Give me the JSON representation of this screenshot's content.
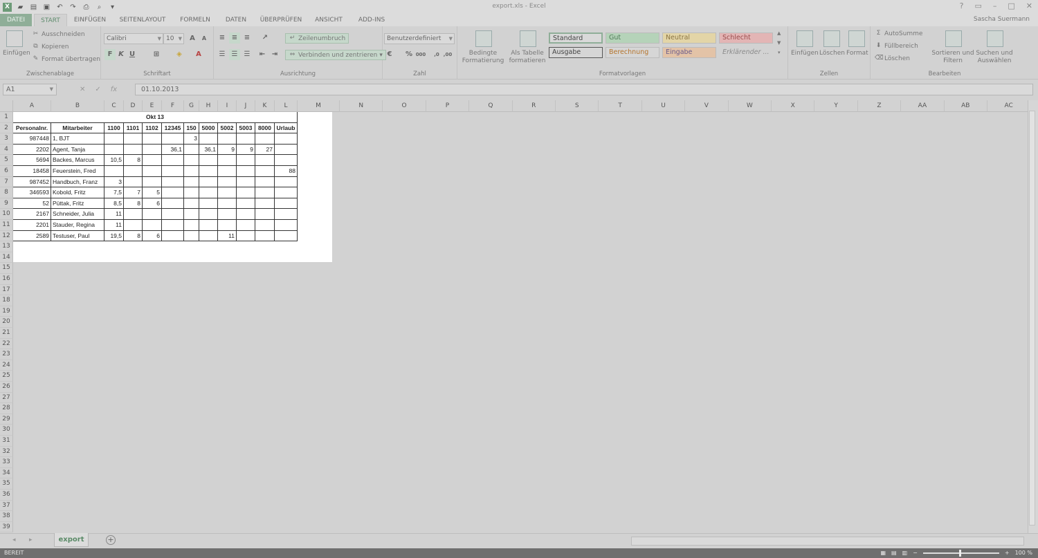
{
  "window": {
    "title": "export.xls - Excel",
    "user": "Sascha Suermann"
  },
  "menu": {
    "tabs": [
      "DATEI",
      "START",
      "EINFÜGEN",
      "SEITENLAYOUT",
      "FORMELN",
      "DATEN",
      "ÜBERPRÜFEN",
      "ANSICHT",
      "ADD-INS"
    ]
  },
  "ribbon": {
    "clipboard": {
      "label": "Zwischenablage",
      "paste": "Einfügen",
      "cut": "Ausschneiden",
      "copy": "Kopieren",
      "format_painter": "Format übertragen"
    },
    "font": {
      "label": "Schriftart",
      "family": "Calibri",
      "size": "10",
      "bold": "F",
      "italic": "K",
      "underline": "U"
    },
    "alignment": {
      "label": "Ausrichtung",
      "wrap": "Zeilenumbruch",
      "merge": "Verbinden und zentrieren"
    },
    "number": {
      "label": "Zahl",
      "format": "Benutzerdefiniert",
      "percent": "%",
      "thousands": "000"
    },
    "styles": {
      "label": "Formatvorlagen",
      "conditional": "Bedingte Formatierung",
      "as_table": "Als Tabelle formatieren",
      "items": [
        {
          "name": "Standard",
          "bg": "#d9d9d9",
          "fg": "#444444"
        },
        {
          "name": "Gut",
          "bg": "#b5d3b9",
          "fg": "#4f7a58"
        },
        {
          "name": "Neutral",
          "bg": "#e3d5a7",
          "fg": "#8a7443"
        },
        {
          "name": "Schlecht",
          "bg": "#e3b5b5",
          "fg": "#9a4c4c"
        },
        {
          "name": "Ausgabe",
          "bg": "#d6d6d6",
          "fg": "#444444"
        },
        {
          "name": "Berechnung",
          "bg": "#d6d6d6",
          "fg": "#b5742c"
        },
        {
          "name": "Eingabe",
          "bg": "#e3c3a7",
          "fg": "#6a5a8a"
        },
        {
          "name": "Erklärender ...",
          "bg": "#d2d2d2",
          "fg": "#8a8a8a"
        }
      ]
    },
    "cells": {
      "label": "Zellen",
      "insert": "Einfügen",
      "delete": "Löschen",
      "format": "Format"
    },
    "editing": {
      "label": "Bearbeiten",
      "autosum": "AutoSumme",
      "fill": "Füllbereich",
      "clear": "Löschen",
      "sort": "Sortieren und Filtern",
      "find": "Suchen und Auswählen"
    }
  },
  "formula": {
    "namebox": "A1",
    "value": "01.10.2013"
  },
  "grid": {
    "columns": [
      "A",
      "B",
      "C",
      "D",
      "E",
      "F",
      "G",
      "H",
      "I",
      "J",
      "K",
      "L",
      "M",
      "N",
      "O",
      "P",
      "Q",
      "R",
      "S",
      "T",
      "U",
      "V",
      "W",
      "X",
      "Y",
      "Z",
      "AA",
      "AB",
      "AC"
    ],
    "row_count": 39,
    "title": "Okt 13",
    "headers": [
      "Personalnr.",
      "Mitarbeiter",
      "1100",
      "1101",
      "1102",
      "12345",
      "150",
      "5000",
      "5002",
      "5003",
      "8000",
      "Urlaub"
    ],
    "rows": [
      [
        "987448",
        "1, BJT",
        "",
        "",
        "",
        "",
        "3",
        "",
        "",
        "",
        "",
        ""
      ],
      [
        "2202",
        "Agent, Tanja",
        "",
        "",
        "",
        "36,1",
        "",
        "36,1",
        "9",
        "9",
        "27",
        ""
      ],
      [
        "5694",
        "Backes, Marcus",
        "10,5",
        "8",
        "",
        "",
        "",
        "",
        "",
        "",
        "",
        ""
      ],
      [
        "18458",
        "Feuerstein, Fred",
        "",
        "",
        "",
        "",
        "",
        "",
        "",
        "",
        "",
        "88"
      ],
      [
        "987452",
        "Handbuch, Franz",
        "3",
        "",
        "",
        "",
        "",
        "",
        "",
        "",
        "",
        ""
      ],
      [
        "346593",
        "Kobold, Fritz",
        "7,5",
        "7",
        "5",
        "",
        "",
        "",
        "",
        "",
        "",
        ""
      ],
      [
        "52",
        "Püttak, Fritz",
        "8,5",
        "8",
        "6",
        "",
        "",
        "",
        "",
        "",
        "",
        ""
      ],
      [
        "2167",
        "Schneider, Julia",
        "11",
        "",
        "",
        "",
        "",
        "",
        "",
        "",
        "",
        ""
      ],
      [
        "2201",
        "Stauder, Regina",
        "11",
        "",
        "",
        "",
        "",
        "",
        "",
        "",
        "",
        ""
      ],
      [
        "2589",
        "Testuser, Paul",
        "19,5",
        "8",
        "6",
        "",
        "",
        "",
        "11",
        "",
        "",
        ""
      ]
    ]
  },
  "sheet": {
    "tab": "export",
    "add": "+"
  },
  "status": {
    "text": "BEREIT",
    "zoom": "100 %"
  }
}
